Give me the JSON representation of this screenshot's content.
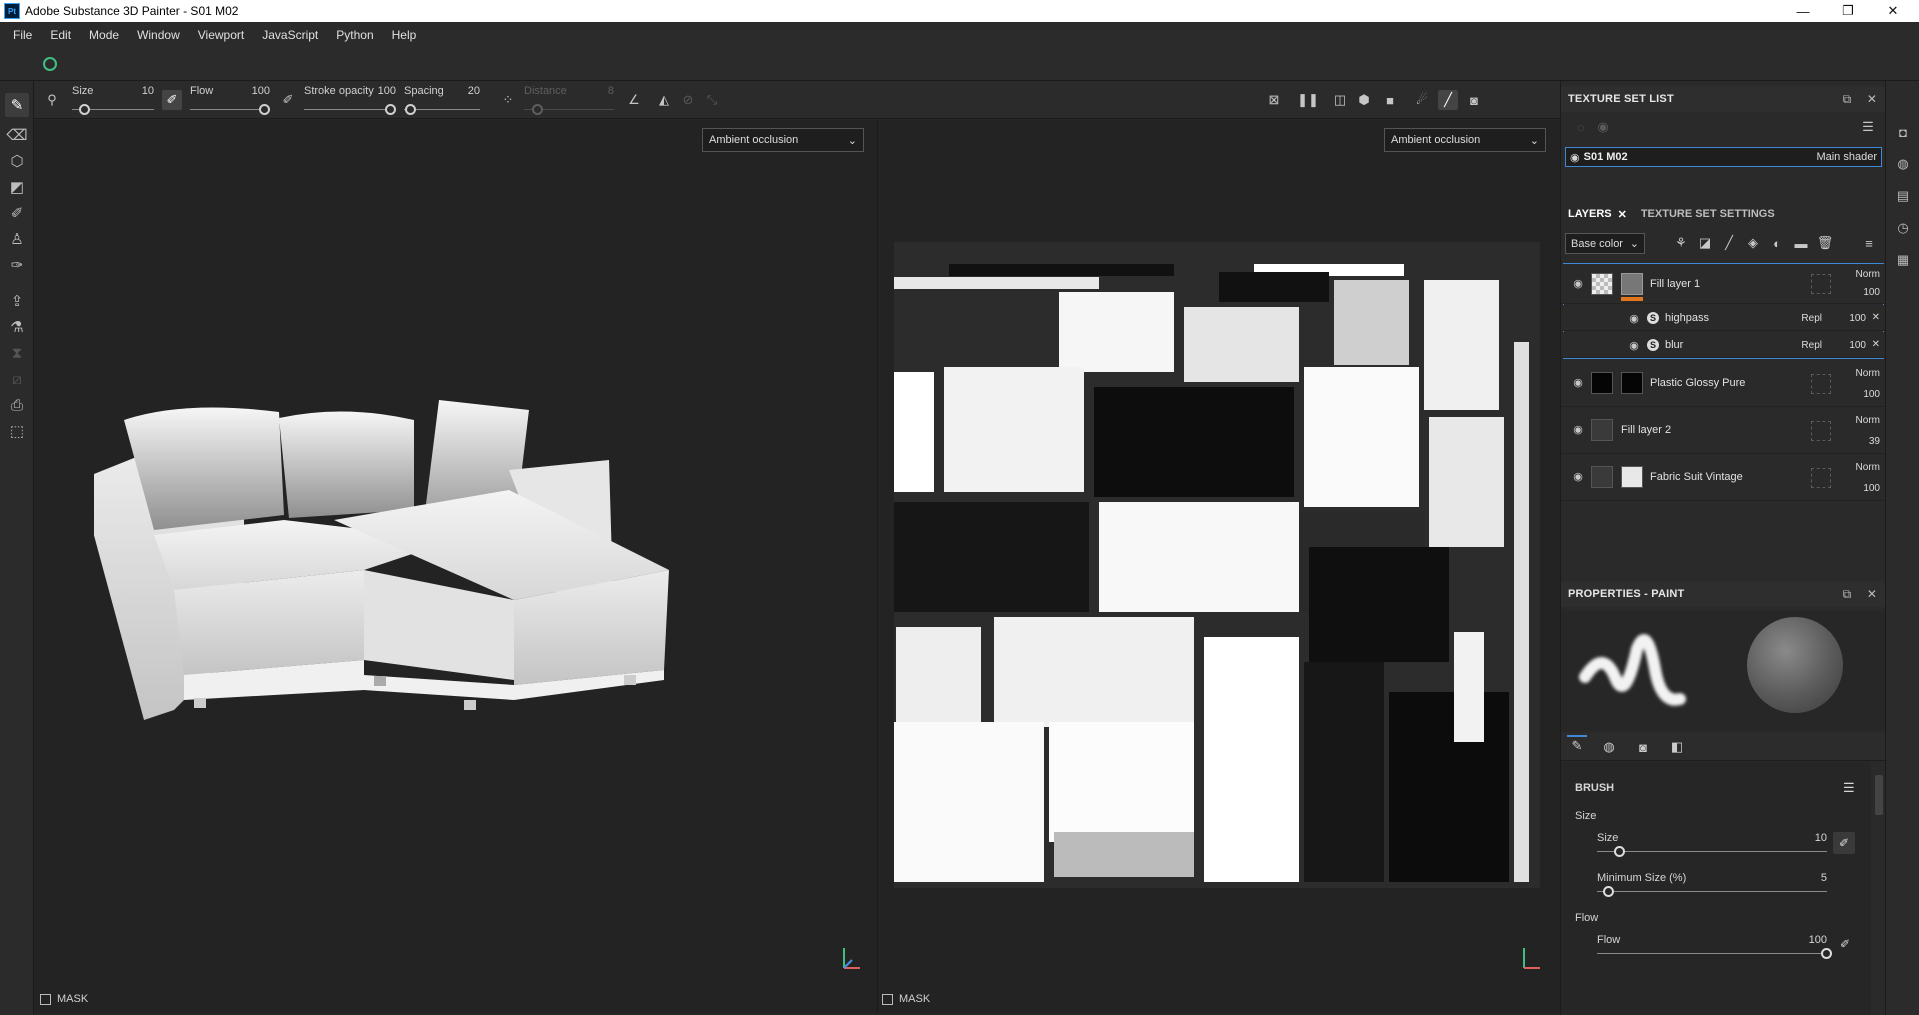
{
  "window": {
    "app_icon": "Pt",
    "title": "Adobe Substance 3D Painter - S01 M02",
    "minimize": "—",
    "maximize": "❐",
    "close": "✕"
  },
  "menu": [
    "File",
    "Edit",
    "Mode",
    "Window",
    "Viewport",
    "JavaScript",
    "Python",
    "Help"
  ],
  "tool_options": {
    "size": {
      "label": "Size",
      "value": "10",
      "level": 0.1
    },
    "flow": {
      "label": "Flow",
      "value": "100",
      "level": 1.0
    },
    "stroke_opacity": {
      "label": "Stroke opacity",
      "value": "100",
      "level": 1.0
    },
    "spacing": {
      "label": "Spacing",
      "value": "20",
      "level": 0.02
    },
    "distance": {
      "label": "Distance",
      "value": "8",
      "level": 0.1
    }
  },
  "viewports": {
    "view3d_channel": "Ambient occlusion",
    "view2d_channel": "Ambient occlusion",
    "mask_label_3d": "MASK",
    "mask_label_2d": "MASK"
  },
  "texture_set_list": {
    "title": "TEXTURE SET LIST",
    "set_name": "S01 M02",
    "shader": "Main shader"
  },
  "layers_panel": {
    "tab_layers": "LAYERS",
    "tab_texture_set_settings": "TEXTURE SET SETTINGS",
    "channel": "Base color",
    "layers": [
      {
        "name": "Fill layer 1",
        "blend": "Norm",
        "opacity": "100"
      },
      {
        "name": "highpass",
        "blend": "Repl",
        "opacity": "100"
      },
      {
        "name": "blur",
        "blend": "Repl",
        "opacity": "100"
      },
      {
        "name": "Plastic Glossy Pure",
        "blend": "Norm",
        "opacity": "100"
      },
      {
        "name": "Fill layer 2",
        "blend": "Norm",
        "opacity": "39"
      },
      {
        "name": "Fabric Suit Vintage",
        "blend": "Norm",
        "opacity": "100"
      }
    ]
  },
  "properties": {
    "title": "PROPERTIES - PAINT",
    "section": "BRUSH",
    "group_size": "Size",
    "size": {
      "label": "Size",
      "value": "10",
      "level": 0.1
    },
    "min_size": {
      "label": "Minimum Size (%)",
      "value": "5",
      "level": 0.05
    },
    "group_flow": "Flow",
    "flow": {
      "label": "Flow",
      "value": "100",
      "level": 1.0
    }
  },
  "colors": {
    "accent": "#3f88d6",
    "orange_marker": "#e2771e",
    "sync_green": "#3fc07f"
  }
}
